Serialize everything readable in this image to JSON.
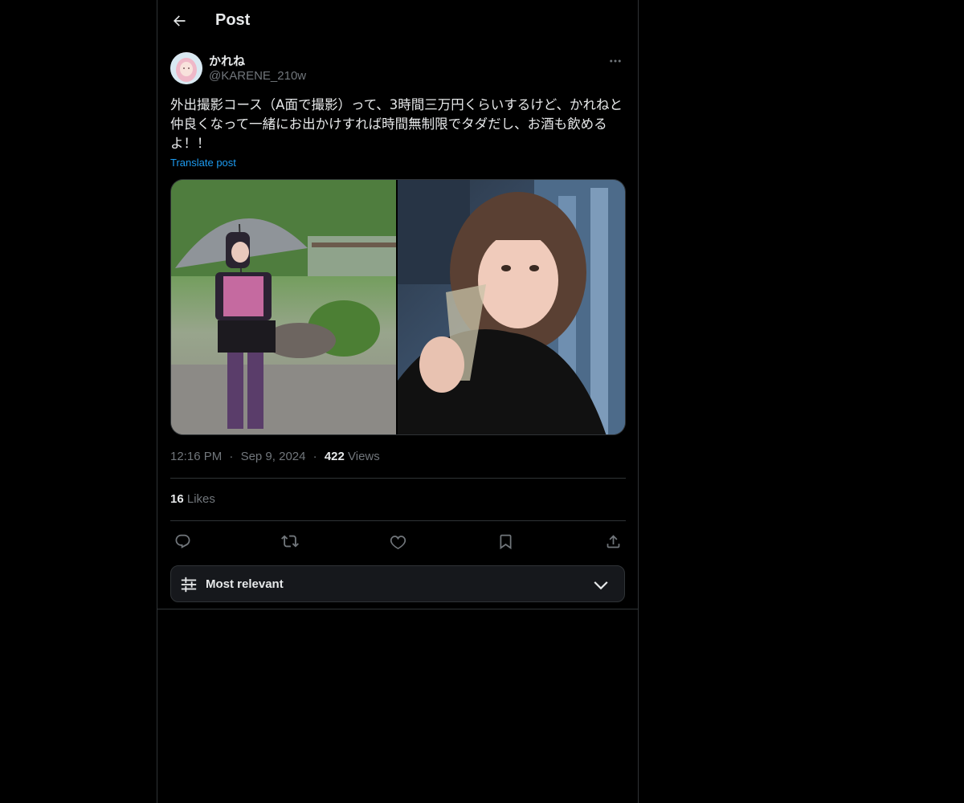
{
  "header": {
    "title": "Post",
    "back_icon": "arrow-left-icon"
  },
  "author": {
    "display_name": "かれね",
    "handle": "@KARENE_210w"
  },
  "post": {
    "text": "外出撮影コース（A面で撮影）って、3時間三万円くらいするけど、かれねと仲良くなって一緒にお出かけすれば時間無制限でタダだし、お酒も飲めるよ！！",
    "translate_label": "Translate post",
    "time": "12:16 PM",
    "date": "Sep 9, 2024",
    "separator": "·",
    "views_count": "422",
    "views_label": "Views",
    "likes_count": "16",
    "likes_label": "Likes"
  },
  "media": [
    {
      "name": "photo-umbrella",
      "icon": "image"
    },
    {
      "name": "photo-champagne",
      "icon": "image"
    }
  ],
  "actions": [
    "reply-icon",
    "repost-icon",
    "like-icon",
    "bookmark-icon",
    "share-icon"
  ],
  "sort": {
    "label": "Most relevant",
    "icon": "sliders-icon",
    "chevron": "chevron-down-icon"
  },
  "colors": {
    "background": "#000000",
    "text": "#e7e9ea",
    "muted": "#71767b",
    "link": "#1d9bf0",
    "border": "#2f3336"
  }
}
